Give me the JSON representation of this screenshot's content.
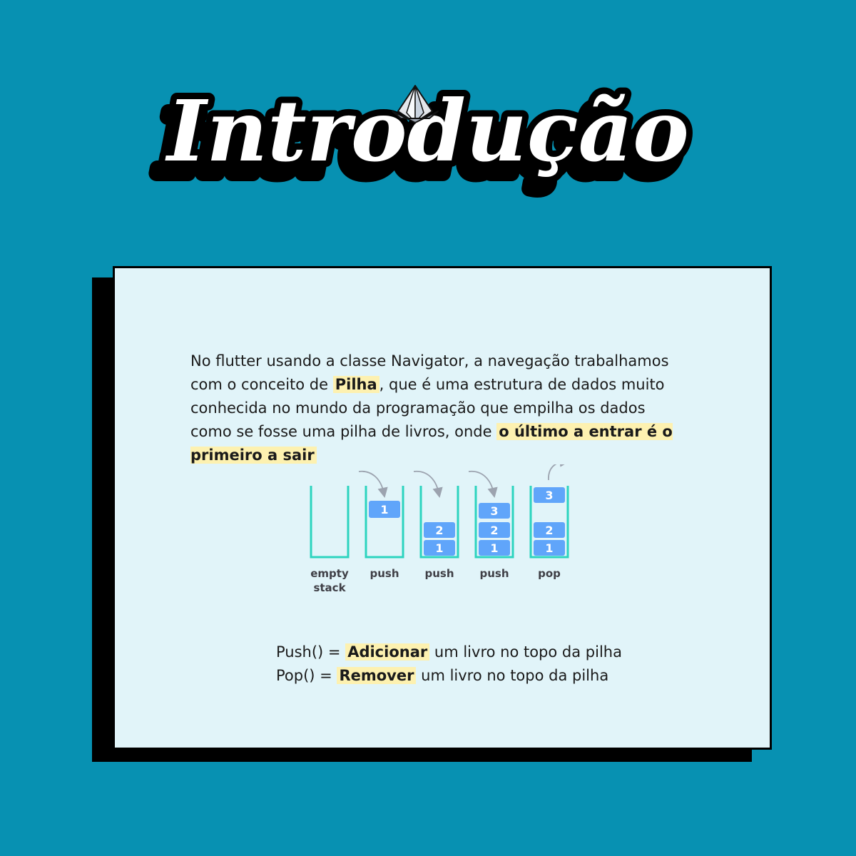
{
  "title": "Introdução",
  "colors": {
    "background": "#0791b2",
    "card": "#e1f4f9",
    "highlight": "#fdf1b0",
    "stack_outline": "#2dd4bf",
    "block": "#60a5fa"
  },
  "paragraph": {
    "part1": "No flutter usando a classe Navigator, a navegação trabalhamos com o conceito de ",
    "highlight1": "Pilha",
    "part2": ", que é uma estrutura de dados muito conhecida no mundo da programação que empilha os dados como se fosse uma pilha de livros, onde ",
    "highlight2": "o último a entrar é o primeiro a sair"
  },
  "diagram": {
    "stacks": [
      {
        "label_lines": [
          "empty",
          "stack"
        ],
        "blocks": []
      },
      {
        "label_lines": [
          "push"
        ],
        "blocks": [
          "1"
        ]
      },
      {
        "label_lines": [
          "push"
        ],
        "blocks": [
          "1",
          "2"
        ]
      },
      {
        "label_lines": [
          "push"
        ],
        "blocks": [
          "1",
          "2",
          "3"
        ]
      },
      {
        "label_lines": [
          "pop"
        ],
        "blocks": [
          "1",
          "2"
        ],
        "popped": "3"
      }
    ]
  },
  "operations": [
    {
      "prefix": "Push() = ",
      "highlight": "Adicionar",
      "suffix": " um livro no topo da pilha"
    },
    {
      "prefix": "Pop() = ",
      "highlight": "Remover",
      "suffix": " um livro no topo da pilha"
    }
  ],
  "icons": {
    "title_decoration": "paper-boat-icon"
  }
}
